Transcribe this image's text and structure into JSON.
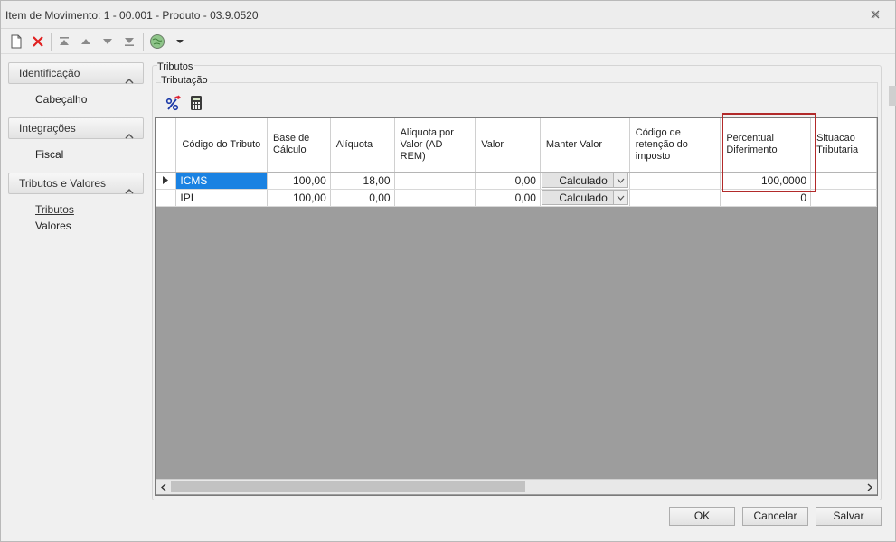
{
  "window": {
    "title": "Item de Movimento: 1 - 00.001 - Produto - 03.9.0520"
  },
  "toolbar": {
    "icons": [
      "new-icon",
      "delete-icon",
      "first-icon",
      "previous-icon",
      "next-icon",
      "last-icon",
      "globe-icon",
      "dropdown-arrow-icon"
    ]
  },
  "nav": {
    "groups": [
      {
        "label": "Identificação",
        "items": [
          "Cabeçalho"
        ]
      },
      {
        "label": "Integrações",
        "items": [
          "Fiscal"
        ]
      },
      {
        "label": "Tributos e Valores",
        "items": [
          "Tributos",
          "Valores"
        ]
      }
    ]
  },
  "content": {
    "group_label": "Tributos",
    "subgroup_label": "Tributação"
  },
  "grid": {
    "columns": [
      "Código do Tributo",
      "Base de Cálculo",
      "Alíquota",
      "Alíquota por Valor (AD REM)",
      "Valor",
      "Manter Valor",
      "Código de retenção do imposto",
      "Percentual Diferimento",
      "Situacao Tributaria"
    ],
    "rows": [
      {
        "codigo": "ICMS",
        "base": "100,00",
        "aliquota": "18,00",
        "aliq_valor": "",
        "valor": "0,00",
        "manter": "Calculado",
        "retencao": "",
        "percentual": "100,0000",
        "situacao": ""
      },
      {
        "codigo": "IPI",
        "base": "100,00",
        "aliquota": "0,00",
        "aliq_valor": "",
        "valor": "0,00",
        "manter": "Calculado",
        "retencao": "",
        "percentual": "0",
        "situacao": ""
      }
    ]
  },
  "buttons": {
    "ok": "OK",
    "cancel": "Cancelar",
    "save": "Salvar"
  },
  "colors": {
    "selection": "#1a82e2",
    "highlight_box": "#b22a2a",
    "empty_grid": "#9d9d9d"
  }
}
